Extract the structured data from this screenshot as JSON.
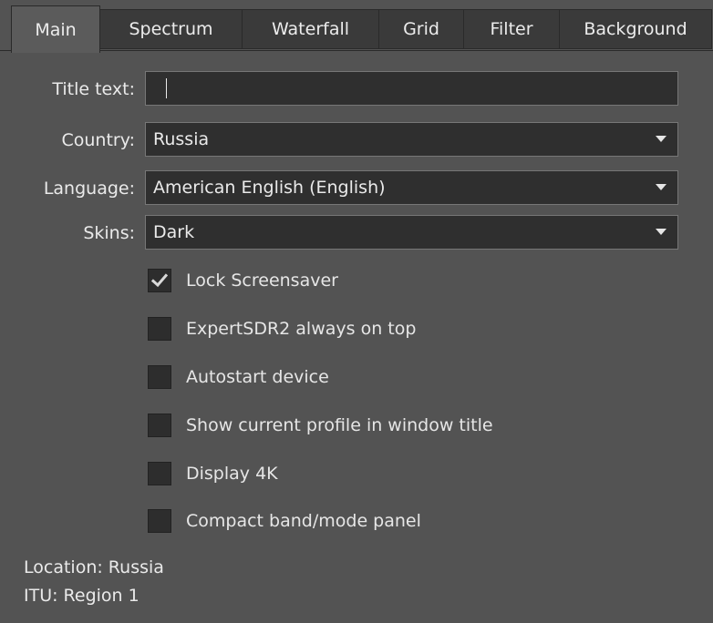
{
  "tabs": [
    {
      "label": "Main",
      "active": true
    },
    {
      "label": "Spectrum",
      "active": false
    },
    {
      "label": "Waterfall",
      "active": false
    },
    {
      "label": "Grid",
      "active": false
    },
    {
      "label": "Filter",
      "active": false
    },
    {
      "label": "Background",
      "active": false
    }
  ],
  "form": {
    "title_label": "Title text:",
    "title_value": "",
    "country_label": "Country:",
    "country_value": "Russia",
    "language_label": "Language:",
    "language_value": "American English (English)",
    "skins_label": "Skins:",
    "skins_value": "Dark"
  },
  "checkboxes": [
    {
      "label": "Lock Screensaver",
      "checked": true
    },
    {
      "label": "ExpertSDR2 always on top",
      "checked": false
    },
    {
      "label": "Autostart device",
      "checked": false
    },
    {
      "label": "Show current profile in window title",
      "checked": false
    },
    {
      "label": "Display 4K",
      "checked": false
    },
    {
      "label": "Compact band/mode panel",
      "checked": false
    }
  ],
  "footer": {
    "location": "Location: Russia",
    "itu": "ITU: Region 1"
  },
  "colors": {
    "background": "#535353",
    "field": "#2f2f2f",
    "tab_inactive": "#3a3a3a",
    "text": "#eaeaea"
  },
  "icons": {
    "dropdown": "chevron-down-icon",
    "check": "checkmark-icon"
  }
}
